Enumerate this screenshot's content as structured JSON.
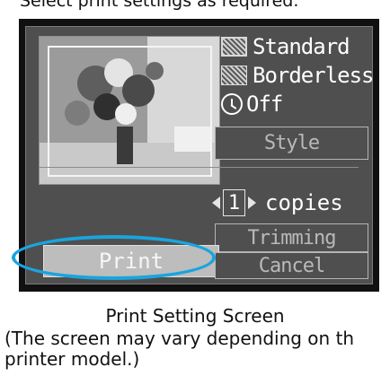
{
  "instruction": "Select print settings as required.",
  "screen": {
    "options": [
      {
        "label": "Standard",
        "icon": "paper-size-icon"
      },
      {
        "label": "Borderless",
        "icon": "borderless-icon"
      },
      {
        "label": "Off",
        "icon": "clock-icon"
      }
    ],
    "style_label": "Style",
    "copies": {
      "count": "1",
      "label": "copies"
    },
    "trimming_label": "Trimming",
    "cancel_label": "Cancel",
    "print_label": "Print",
    "highlight_color": "#1aa4de"
  },
  "captions": {
    "title": "Print Setting Screen",
    "note_line1": "(The screen may vary depending on th",
    "note_line2": "printer model.)"
  }
}
